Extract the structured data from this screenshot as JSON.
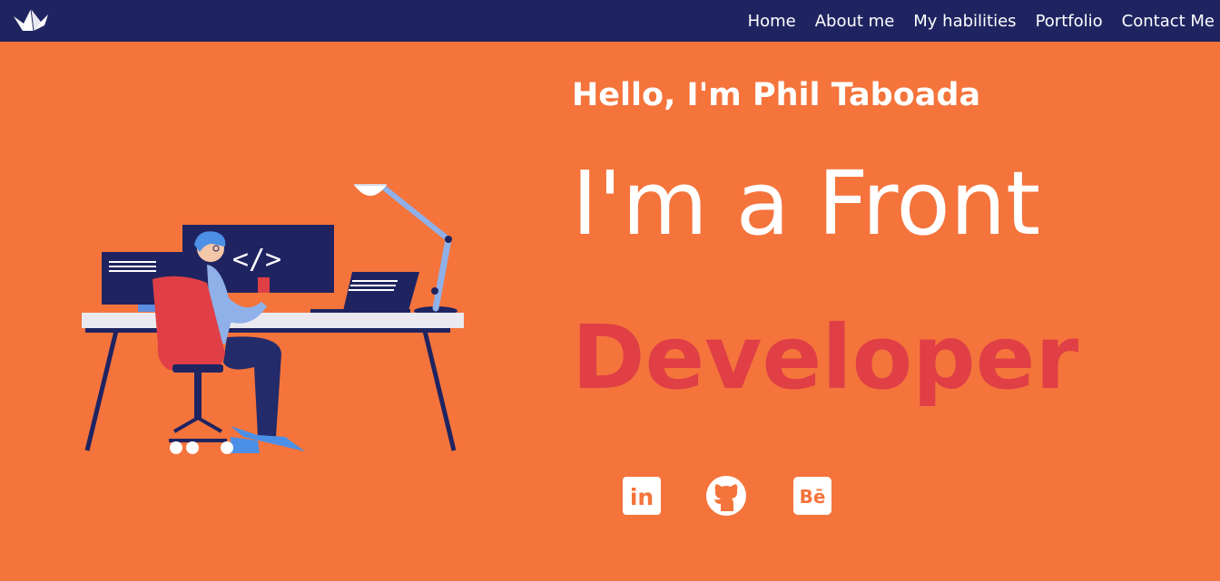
{
  "nav": {
    "logo_icon": "origami-crane-icon",
    "links": [
      "Home",
      "About me",
      "My habilities",
      "Portfolio",
      "Contact Me"
    ]
  },
  "hero": {
    "greeting": "Hello, I'm Phil Taboada",
    "title_line1": "I'm a Front",
    "title_line2": "Developer",
    "illustration": "developer-at-desk-illustration"
  },
  "social": [
    {
      "name": "linkedin-icon",
      "label": "in"
    },
    {
      "name": "github-icon"
    },
    {
      "name": "behance-icon",
      "label": "Bē"
    }
  ],
  "colors": {
    "background": "#f4743c",
    "navbar": "#1f2461",
    "accent": "#df3f45",
    "text": "#ffffff"
  }
}
